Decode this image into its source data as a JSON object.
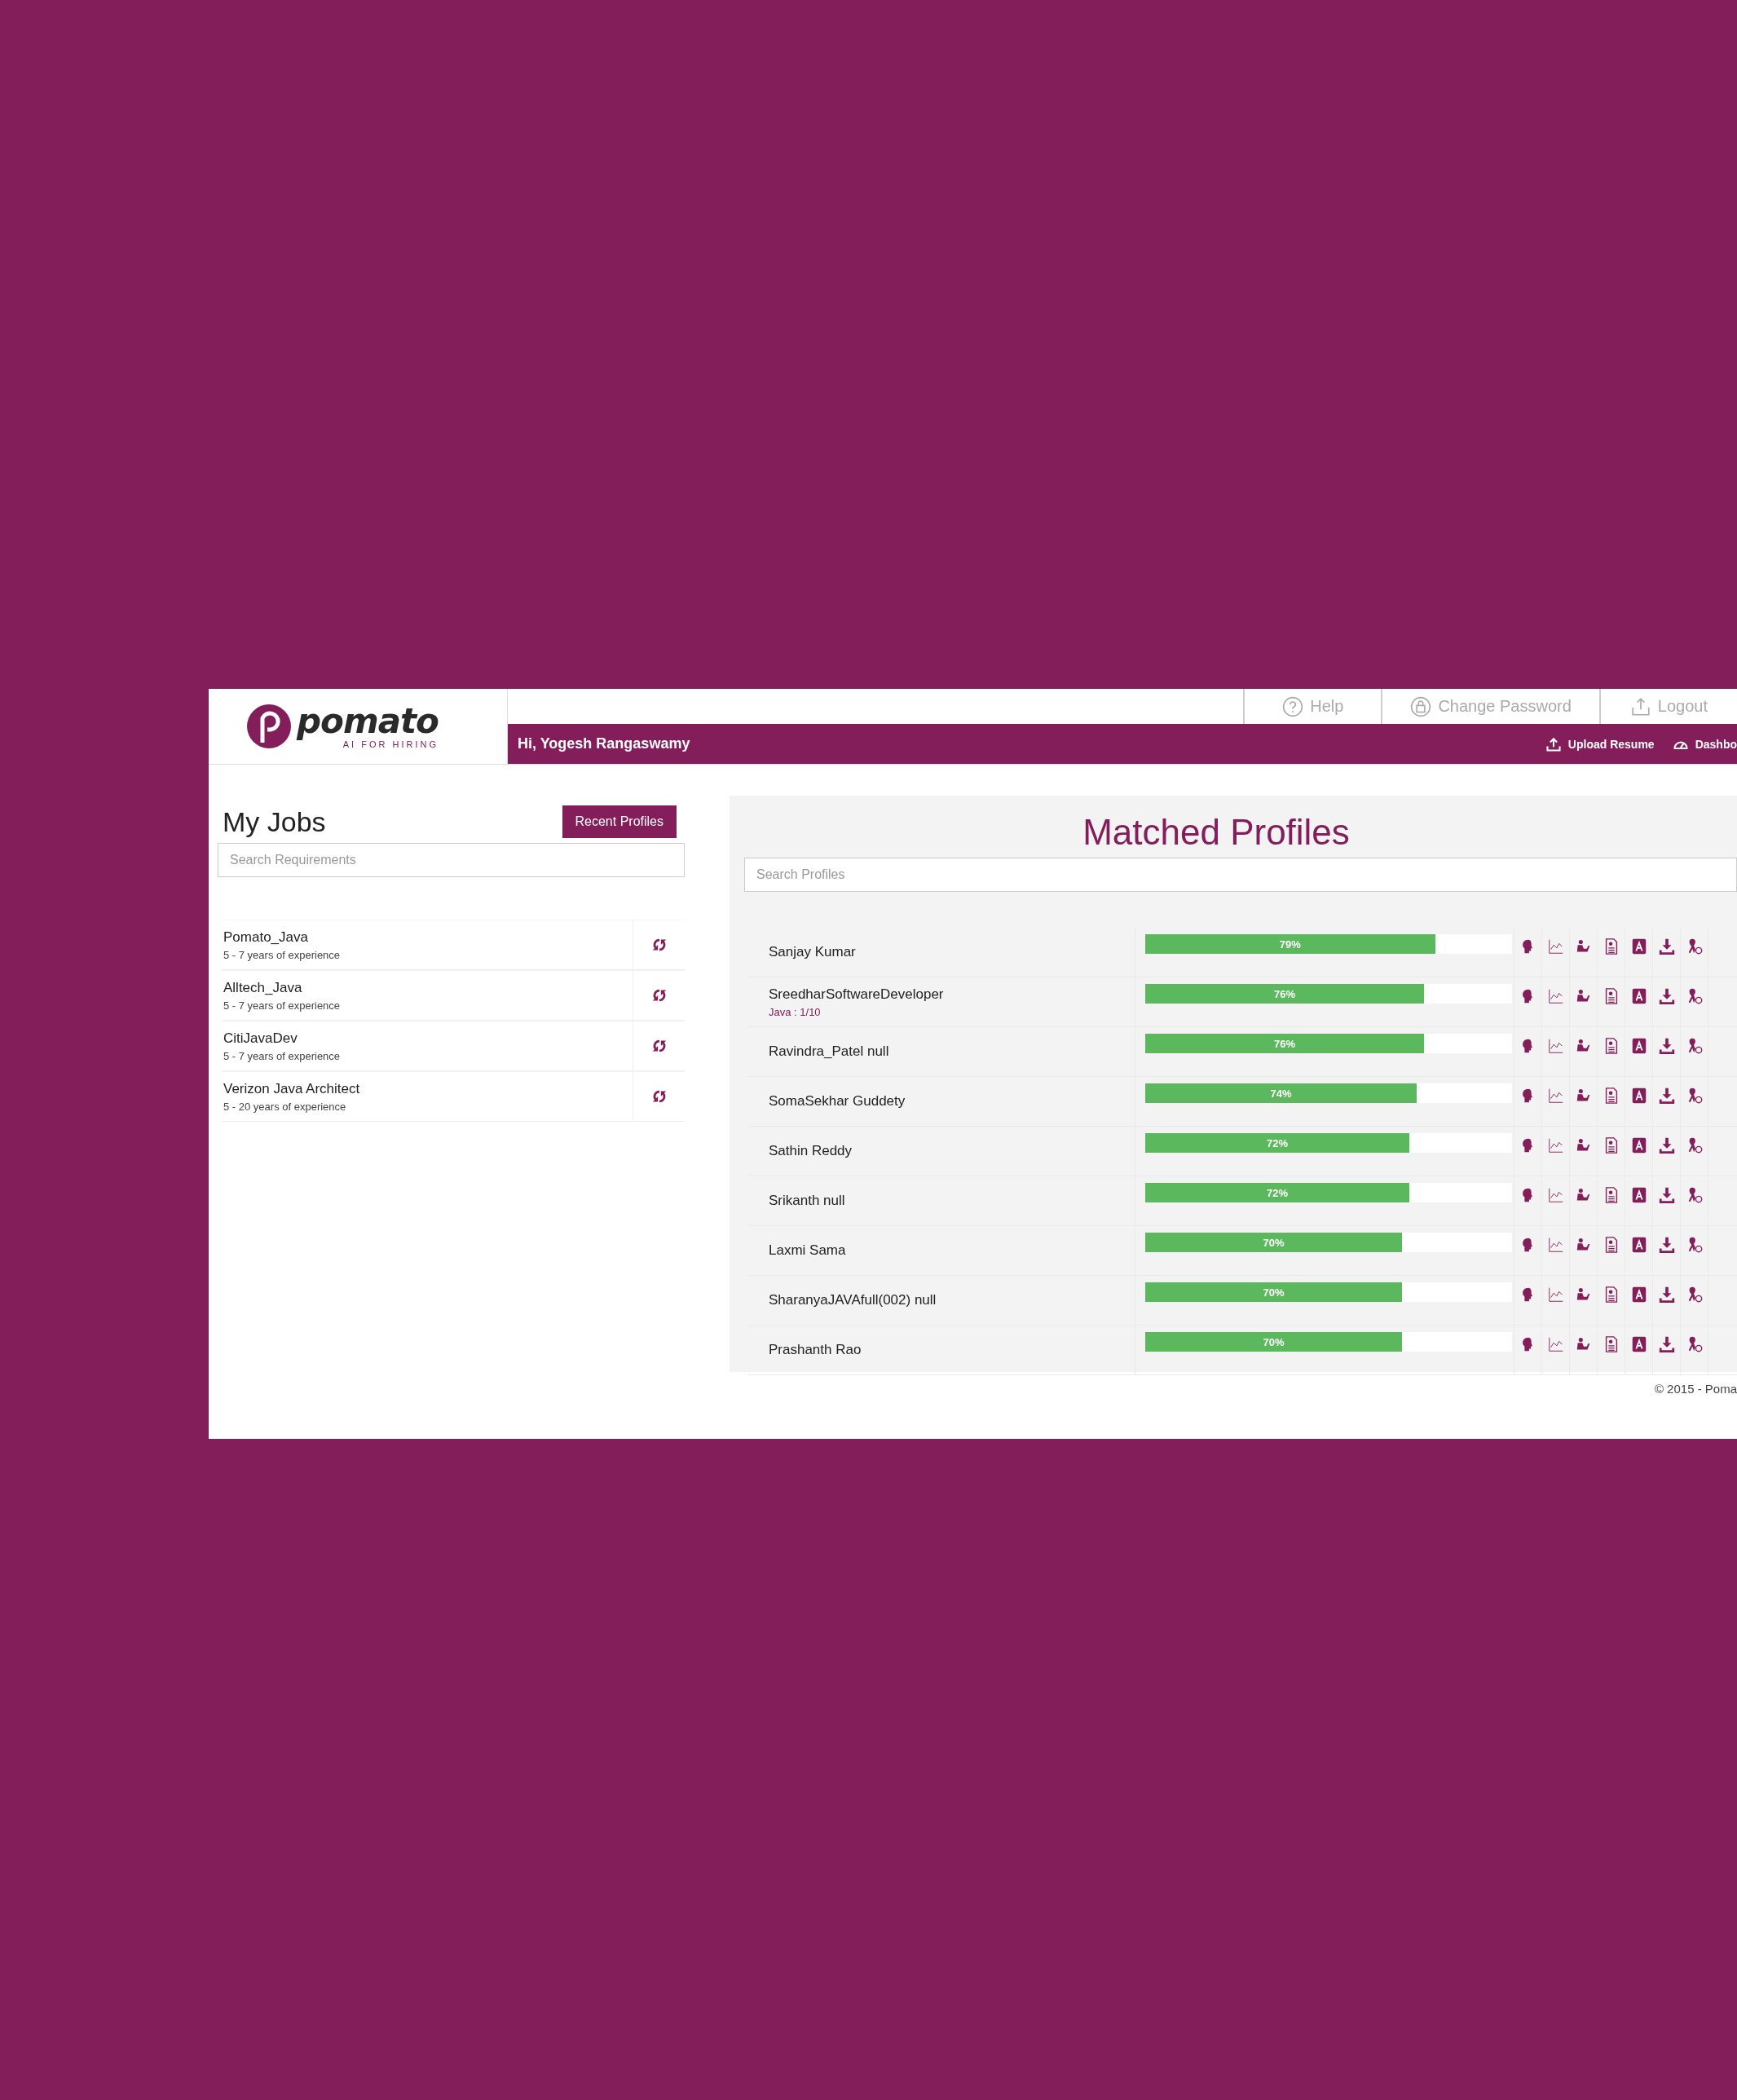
{
  "logo": {
    "name": "pomato",
    "tagline": "AI FOR HIRING"
  },
  "top_links": [
    {
      "label": "Help",
      "kind": "help"
    },
    {
      "label": "Change Password",
      "kind": "lock"
    },
    {
      "label": "Logout",
      "kind": "logout"
    }
  ],
  "greeting": "Hi, Yogesh Rangaswamy",
  "nav_links": [
    {
      "label": "Upload Resume",
      "kind": "upload"
    },
    {
      "label": "Dashbo",
      "kind": "dashboard"
    }
  ],
  "my_jobs": {
    "title": "My Jobs",
    "button": "Recent Profiles",
    "search": {
      "placeholder": "Search Requirements"
    },
    "jobs": [
      {
        "name": "Pomato_Java",
        "experience": "5 - 7 years of experience"
      },
      {
        "name": "Alltech_Java",
        "experience": "5 - 7 years of experience"
      },
      {
        "name": "CitiJavaDev",
        "experience": "5 - 7 years of experience"
      },
      {
        "name": "Verizon Java Architect",
        "experience": "5 - 20 years of experience"
      }
    ]
  },
  "matched_profiles": {
    "title": "Matched Profiles",
    "search": {
      "placeholder": "Search Profiles"
    },
    "profiles": [
      {
        "name": "Sanjay Kumar",
        "level": 0.79,
        "reading": "79%"
      },
      {
        "name": "SreedharSoftwareDeveloper",
        "detail": "Java : 1/10",
        "level": 0.76,
        "reading": "76%"
      },
      {
        "name": "Ravindra_Patel null",
        "level": 0.76,
        "reading": "76%"
      },
      {
        "name": "SomaSekhar Guddety",
        "level": 0.74,
        "reading": "74%"
      },
      {
        "name": "Sathin Reddy",
        "level": 0.72,
        "reading": "72%"
      },
      {
        "name": "Srikanth null",
        "level": 0.72,
        "reading": "72%"
      },
      {
        "name": "Laxmi Sama",
        "level": 0.7,
        "reading": "70%"
      },
      {
        "name": "SharanyaJAVAfull(002) null",
        "level": 0.7,
        "reading": "70%"
      },
      {
        "name": "Prashanth Rao",
        "level": 0.7,
        "reading": "70%"
      }
    ]
  },
  "footer": "© 2015 - Poma"
}
